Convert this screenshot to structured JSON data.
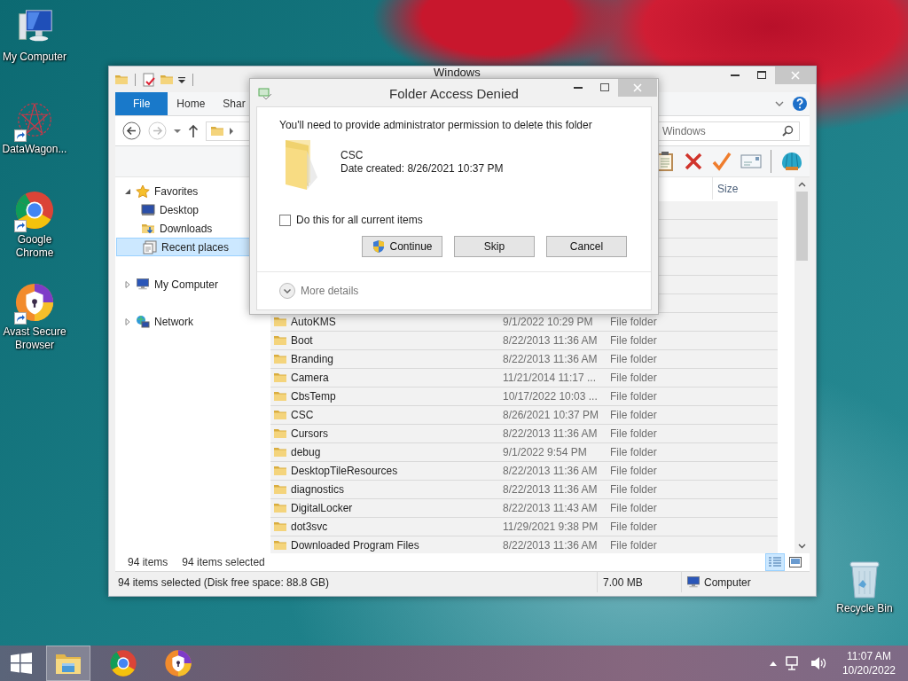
{
  "desktop_icons": [
    {
      "label": "My Computer",
      "kind": "computer",
      "shortcut": false
    },
    {
      "label": "DataWagon...",
      "kind": "mesh",
      "shortcut": true
    },
    {
      "label": "Google Chrome",
      "kind": "chrome",
      "shortcut": true
    },
    {
      "label": "Avast Secure Browser",
      "kind": "avast",
      "shortcut": true
    }
  ],
  "recycle_bin": {
    "label": "Recycle Bin"
  },
  "explorer": {
    "title": "Windows",
    "ribbon_tabs": [
      {
        "label": "File",
        "selected": true
      },
      {
        "label": "Home",
        "selected": false
      },
      {
        "label": "Shar",
        "selected": false
      }
    ],
    "search": {
      "placeholder": "Windows"
    },
    "size_column": "Size",
    "nav_pane": [
      {
        "label": "Favorites",
        "kind": "favorites",
        "expanded": true,
        "selected": false,
        "children": [
          {
            "label": "Desktop",
            "kind": "desktop",
            "selected": false
          },
          {
            "label": "Downloads",
            "kind": "downloads",
            "selected": false
          },
          {
            "label": "Recent places",
            "kind": "recent",
            "selected": true
          }
        ]
      },
      {
        "label": "My Computer",
        "kind": "computer",
        "expanded": false,
        "selected": false
      },
      {
        "label": "Network",
        "kind": "network",
        "expanded": false,
        "selected": false
      }
    ],
    "files": [
      {
        "name": "AutoKMS",
        "date": "9/1/2022 10:29 PM",
        "type": "File folder",
        "selected": true
      },
      {
        "name": "Boot",
        "date": "8/22/2013 11:36 AM",
        "type": "File folder",
        "selected": true
      },
      {
        "name": "Branding",
        "date": "8/22/2013 11:36 AM",
        "type": "File folder",
        "selected": true
      },
      {
        "name": "Camera",
        "date": "11/21/2014 11:17 ...",
        "type": "File folder",
        "selected": true
      },
      {
        "name": "CbsTemp",
        "date": "10/17/2022 10:03 ...",
        "type": "File folder",
        "selected": true
      },
      {
        "name": "CSC",
        "date": "8/26/2021 10:37 PM",
        "type": "File folder",
        "selected": true
      },
      {
        "name": "Cursors",
        "date": "8/22/2013 11:36 AM",
        "type": "File folder",
        "selected": true
      },
      {
        "name": "debug",
        "date": "9/1/2022 9:54 PM",
        "type": "File folder",
        "selected": true
      },
      {
        "name": "DesktopTileResources",
        "date": "8/22/2013 11:36 AM",
        "type": "File folder",
        "selected": true
      },
      {
        "name": "diagnostics",
        "date": "8/22/2013 11:36 AM",
        "type": "File folder",
        "selected": true
      },
      {
        "name": "DigitalLocker",
        "date": "8/22/2013 11:43 AM",
        "type": "File folder",
        "selected": true
      },
      {
        "name": "dot3svc",
        "date": "11/29/2021 9:38 PM",
        "type": "File folder",
        "selected": true
      },
      {
        "name": "Downloaded Program Files",
        "date": "8/22/2013 11:36 AM",
        "type": "File folder",
        "selected": true
      }
    ],
    "item_count": "94 items",
    "selection_count": "94 items selected",
    "view_buttons": [
      {
        "kind": "details",
        "selected": true
      },
      {
        "kind": "thumbnails",
        "selected": false
      }
    ],
    "status_bar": {
      "selection": "94 items selected (Disk free space: 88.8 GB)",
      "size": "7.00 MB",
      "location": "Computer"
    }
  },
  "dialog": {
    "title": "Folder Access Denied",
    "message": "You'll need to provide administrator permission to delete this folder",
    "item_name": "CSC",
    "item_date": "Date created: 8/26/2021 10:37 PM",
    "checkbox": {
      "label": "Do this for all current items",
      "checked": false
    },
    "buttons": [
      {
        "label": "Continue",
        "kind": "elevated"
      },
      {
        "label": "Skip",
        "kind": "plain"
      },
      {
        "label": "Cancel",
        "kind": "plain"
      }
    ],
    "more_details": "More details"
  },
  "taskbar": {
    "apps": [
      {
        "kind": "explorer",
        "active": true
      },
      {
        "kind": "chrome",
        "active": false
      },
      {
        "kind": "avast",
        "active": false
      }
    ],
    "time": "11:07 AM",
    "date": "10/20/2022"
  }
}
